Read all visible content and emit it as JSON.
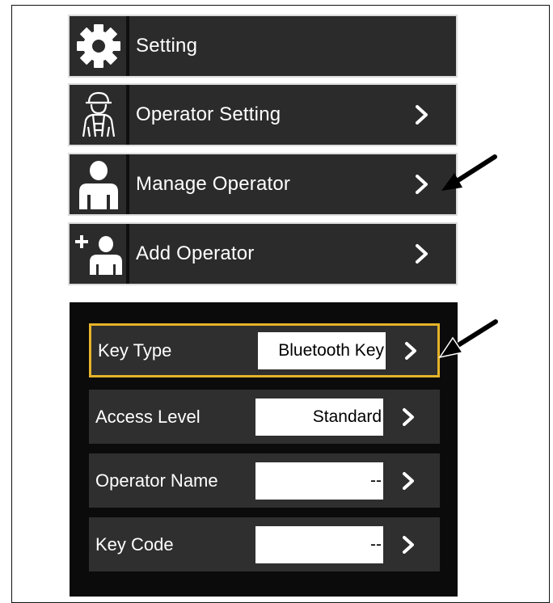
{
  "menu": {
    "items": [
      {
        "label": "Setting",
        "icon": "gear-icon",
        "has_chevron": false
      },
      {
        "label": "Operator Setting",
        "icon": "operator-helmet-icon",
        "has_chevron": true
      },
      {
        "label": "Manage Operator",
        "icon": "person-icon",
        "has_chevron": true
      },
      {
        "label": "Add Operator",
        "icon": "add-person-icon",
        "has_chevron": true
      }
    ]
  },
  "form": {
    "fields": [
      {
        "label": "Key Type",
        "value": "Bluetooth Key",
        "selected": true
      },
      {
        "label": "Access Level",
        "value": "Standard",
        "selected": false
      },
      {
        "label": "Operator Name",
        "value": "--",
        "selected": false
      },
      {
        "label": "Key Code",
        "value": "--",
        "selected": false
      }
    ]
  },
  "colors": {
    "row_background": "#2b2b2b",
    "panel_background": "#0b0b0b",
    "selection_border": "#e5b32a",
    "text": "#ffffff"
  }
}
